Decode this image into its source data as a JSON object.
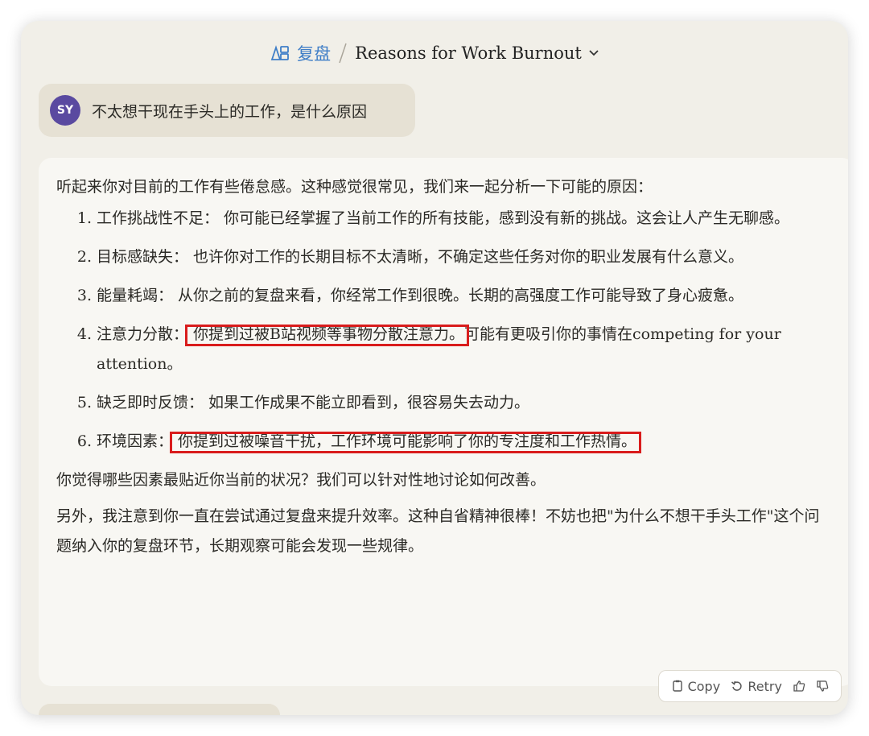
{
  "header": {
    "project_icon": "project-icon",
    "project_name": "复盘",
    "chat_title": "Reasons for Work Burnout",
    "dropdown_icon": "chevron-down-icon"
  },
  "user_message": {
    "avatar_initials": "SY",
    "text": "不太想干现在手头上的工作，是什么原因"
  },
  "assistant_message": {
    "intro": "听起来你对目前的工作有些倦怠感。这种感觉很常见，我们来一起分析一下可能的原因：",
    "items": [
      {
        "num": "1.",
        "title": "工作挑战性不足：",
        "text": " 你可能已经掌握了当前工作的所有技能，感到没有新的挑战。这会让人产生无聊感。"
      },
      {
        "num": "2.",
        "title": "目标感缺失：",
        "text": " 也许你对工作的长期目标不太清晰，不确定这些任务对你的职业发展有什么意义。"
      },
      {
        "num": "3.",
        "title": "能量耗竭：",
        "text": " 从你之前的复盘来看，你经常工作到很晚。长期的高强度工作可能导致了身心疲惫。"
      },
      {
        "num": "4.",
        "title": "注意力分散：",
        "highlight": " 你提到过被B站视频等事物分散注意力。",
        "text": "可能有更吸引你的事情在competing for your attention。"
      },
      {
        "num": "5.",
        "title": "缺乏即时反馈：",
        "text": " 如果工作成果不能立即看到，很容易失去动力。"
      },
      {
        "num": "6.",
        "title": "环境因素：",
        "highlight": " 你提到过被噪音干扰，工作环境可能影响了你的专注度和工作热情。",
        "text": ""
      }
    ],
    "question": "你觉得哪些因素最贴近你当前的状况？我们可以针对性地讨论如何改善。",
    "closing": "另外，我注意到你一直在尝试通过复盘来提升效率。这种自省精神很棒！不妨也把\"为什么不想干手头工作\"这个问题纳入你的复盘环节，长期观察可能会发现一些规律。"
  },
  "actions": {
    "copy_label": "Copy",
    "retry_label": "Retry",
    "thumbs_up_icon": "thumbs-up-icon",
    "thumbs_down_icon": "thumbs-down-icon"
  },
  "colors": {
    "window_bg": "#f1efe8",
    "user_bubble": "#e6e1d4",
    "project_link": "#3f7ec7",
    "avatar": "#5a4aa0",
    "annotation_red": "#d91c1c"
  }
}
